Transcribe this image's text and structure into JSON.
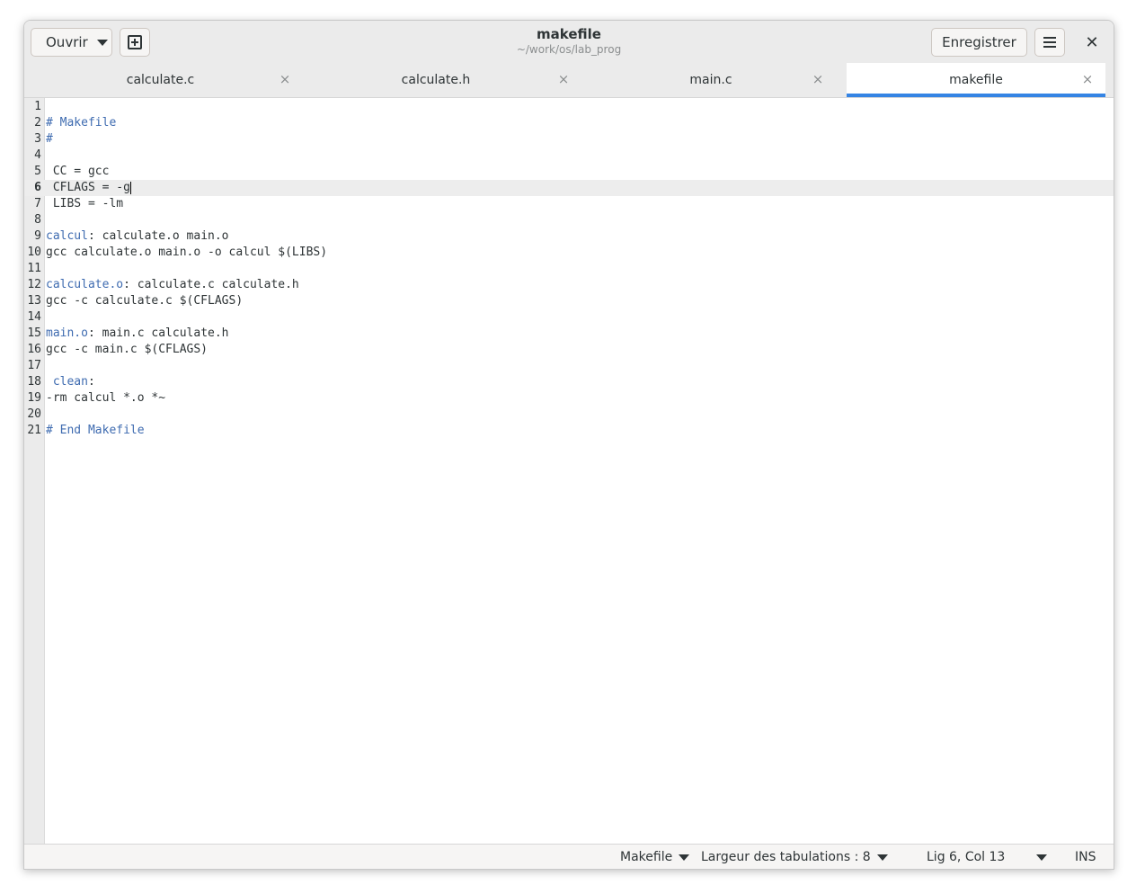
{
  "headerbar": {
    "open_label": "Ouvrir",
    "save_label": "Enregistrer",
    "title": "makefile",
    "subtitle": "~/work/os/lab_prog",
    "close_glyph": "✕"
  },
  "tabs": [
    {
      "label": "calculate.c",
      "close": "×"
    },
    {
      "label": "calculate.h",
      "close": "×"
    },
    {
      "label": "main.c",
      "close": "×"
    },
    {
      "label": "makefile",
      "close": "×",
      "active": true
    }
  ],
  "editor": {
    "current_line": 6,
    "lines": [
      {
        "n": "1",
        "segments": []
      },
      {
        "n": "2",
        "segments": [
          {
            "t": "# Makefile",
            "c": "kw"
          }
        ]
      },
      {
        "n": "3",
        "segments": [
          {
            "t": "#",
            "c": "kw"
          }
        ]
      },
      {
        "n": "4",
        "segments": []
      },
      {
        "n": "5",
        "segments": [
          {
            "t": " CC = gcc",
            "c": ""
          }
        ]
      },
      {
        "n": "6",
        "segments": [
          {
            "t": " CFLAGS = -g",
            "c": ""
          }
        ]
      },
      {
        "n": "7",
        "segments": [
          {
            "t": " LIBS = -lm",
            "c": ""
          }
        ]
      },
      {
        "n": "8",
        "segments": []
      },
      {
        "n": "9",
        "segments": [
          {
            "t": "calcul",
            "c": "kw"
          },
          {
            "t": ": calculate.o main.o",
            "c": ""
          }
        ]
      },
      {
        "n": "10",
        "segments": [
          {
            "t": "gcc calculate.o main.o -o calcul $(LIBS)",
            "c": ""
          }
        ]
      },
      {
        "n": "11",
        "segments": []
      },
      {
        "n": "12",
        "segments": [
          {
            "t": "calculate.o",
            "c": "kw"
          },
          {
            "t": ": calculate.c calculate.h",
            "c": ""
          }
        ]
      },
      {
        "n": "13",
        "segments": [
          {
            "t": "gcc -c calculate.c $(CFLAGS)",
            "c": ""
          }
        ]
      },
      {
        "n": "14",
        "segments": []
      },
      {
        "n": "15",
        "segments": [
          {
            "t": "main.o",
            "c": "kw"
          },
          {
            "t": ": main.c calculate.h",
            "c": ""
          }
        ]
      },
      {
        "n": "16",
        "segments": [
          {
            "t": "gcc -c main.c $(CFLAGS)",
            "c": ""
          }
        ]
      },
      {
        "n": "17",
        "segments": []
      },
      {
        "n": "18",
        "segments": [
          {
            "t": " ",
            "c": ""
          },
          {
            "t": "clean",
            "c": "kw"
          },
          {
            "t": ":",
            "c": ""
          }
        ]
      },
      {
        "n": "19",
        "segments": [
          {
            "t": "-rm calcul *.o *~",
            "c": ""
          }
        ]
      },
      {
        "n": "20",
        "segments": []
      },
      {
        "n": "21",
        "segments": [
          {
            "t": "# End Makefile",
            "c": "kw"
          }
        ]
      }
    ]
  },
  "statusbar": {
    "language": "Makefile",
    "tab_width": "Largeur des tabulations : 8",
    "position": "Lig 6, Col 13",
    "mode": "INS"
  },
  "colors": {
    "accent": "#3584e4",
    "keyword": "#3e6bb0"
  }
}
